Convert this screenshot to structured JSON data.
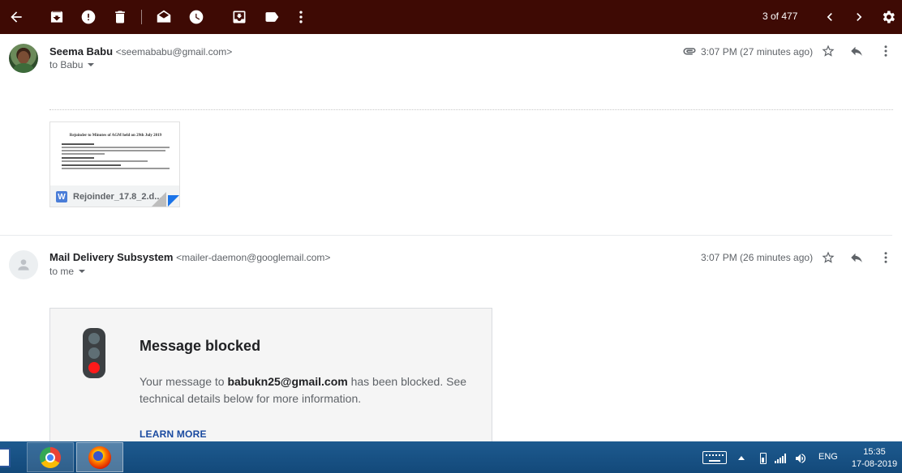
{
  "toolbar": {
    "counter": "3 of 477",
    "icons": [
      "back-arrow-icon",
      "archive-icon",
      "report-spam-icon",
      "delete-icon",
      "mark-unread-icon",
      "snooze-icon",
      "move-to-icon",
      "label-icon",
      "more-vert-icon",
      "chevron-left-icon",
      "chevron-right-icon",
      "gear-icon"
    ],
    "background": "#3e0a04"
  },
  "messages": [
    {
      "sender_name": "Seema Babu",
      "sender_email": "<seemababu@gmail.com>",
      "to": "to Babu",
      "time": "3:07 PM (27 minutes ago)",
      "has_attachment": true,
      "attachment": {
        "filename": "Rejoinder_17.8_2.d...",
        "file_type_letter": "W",
        "preview_title": "Rejoinder to Minutes of AGM held on 29th July 2019"
      }
    },
    {
      "sender_name": "Mail Delivery Subsystem",
      "sender_email": "<mailer-daemon@googlemail.com>",
      "to": "to me",
      "time": "3:07 PM (26 minutes ago)",
      "blocked_card": {
        "title": "Message blocked",
        "text_before": "Your message to ",
        "recipient": "babukn25@gmail.com",
        "text_after": " has been blocked. See technical details below for more information.",
        "link": "LEARN MORE"
      }
    }
  ],
  "taskbar": {
    "apps": [
      "word-icon",
      "chrome-icon",
      "firefox-icon"
    ],
    "language": "ENG",
    "time": "15:35",
    "date": "17-08-2019"
  }
}
